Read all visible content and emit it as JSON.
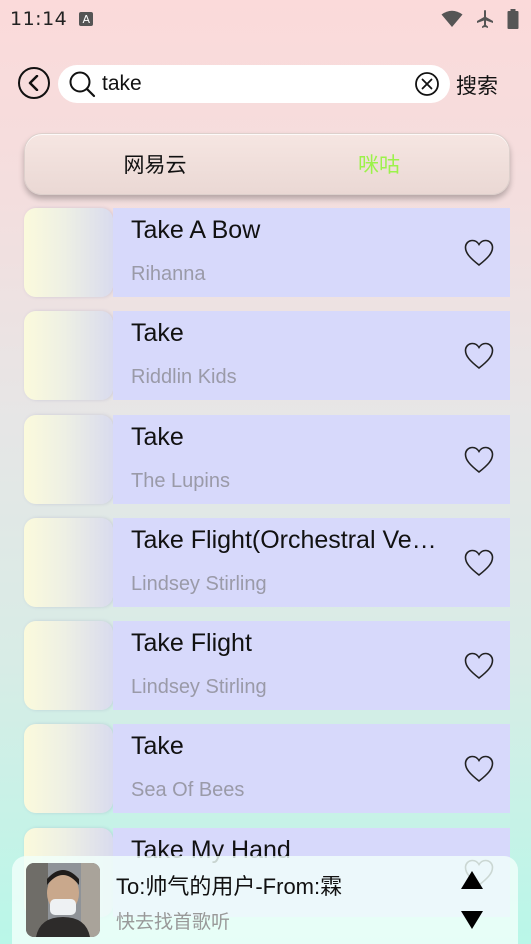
{
  "status_bar": {
    "time": "11:14",
    "notification_badge": "A",
    "icons": [
      "wifi-icon",
      "airplane-mode-icon",
      "battery-icon"
    ]
  },
  "search": {
    "query": "take",
    "submit_label": "搜索"
  },
  "source_tabs": {
    "netease_label": "网易云",
    "migu_label": "咪咕",
    "active": "migu",
    "active_color": "#9cf24b"
  },
  "songs": [
    {
      "title": "Take A Bow",
      "artist": "Rihanna"
    },
    {
      "title": "Take",
      "artist": "Riddlin Kids"
    },
    {
      "title": "Take",
      "artist": "The Lupins"
    },
    {
      "title": "Take Flight(Orchestral Version)",
      "artist": "Lindsey Stirling"
    },
    {
      "title": "Take Flight",
      "artist": "Lindsey Stirling"
    },
    {
      "title": "Take",
      "artist": "Sea Of Bees"
    },
    {
      "title": "Take My Hand",
      "artist": ""
    }
  ],
  "player": {
    "title": "To:帅气的用户-From:霖",
    "subtitle": "快去找首歌听"
  },
  "colors": {
    "song_card": "#d7d9fb",
    "artist_text": "#9a9aa8"
  }
}
